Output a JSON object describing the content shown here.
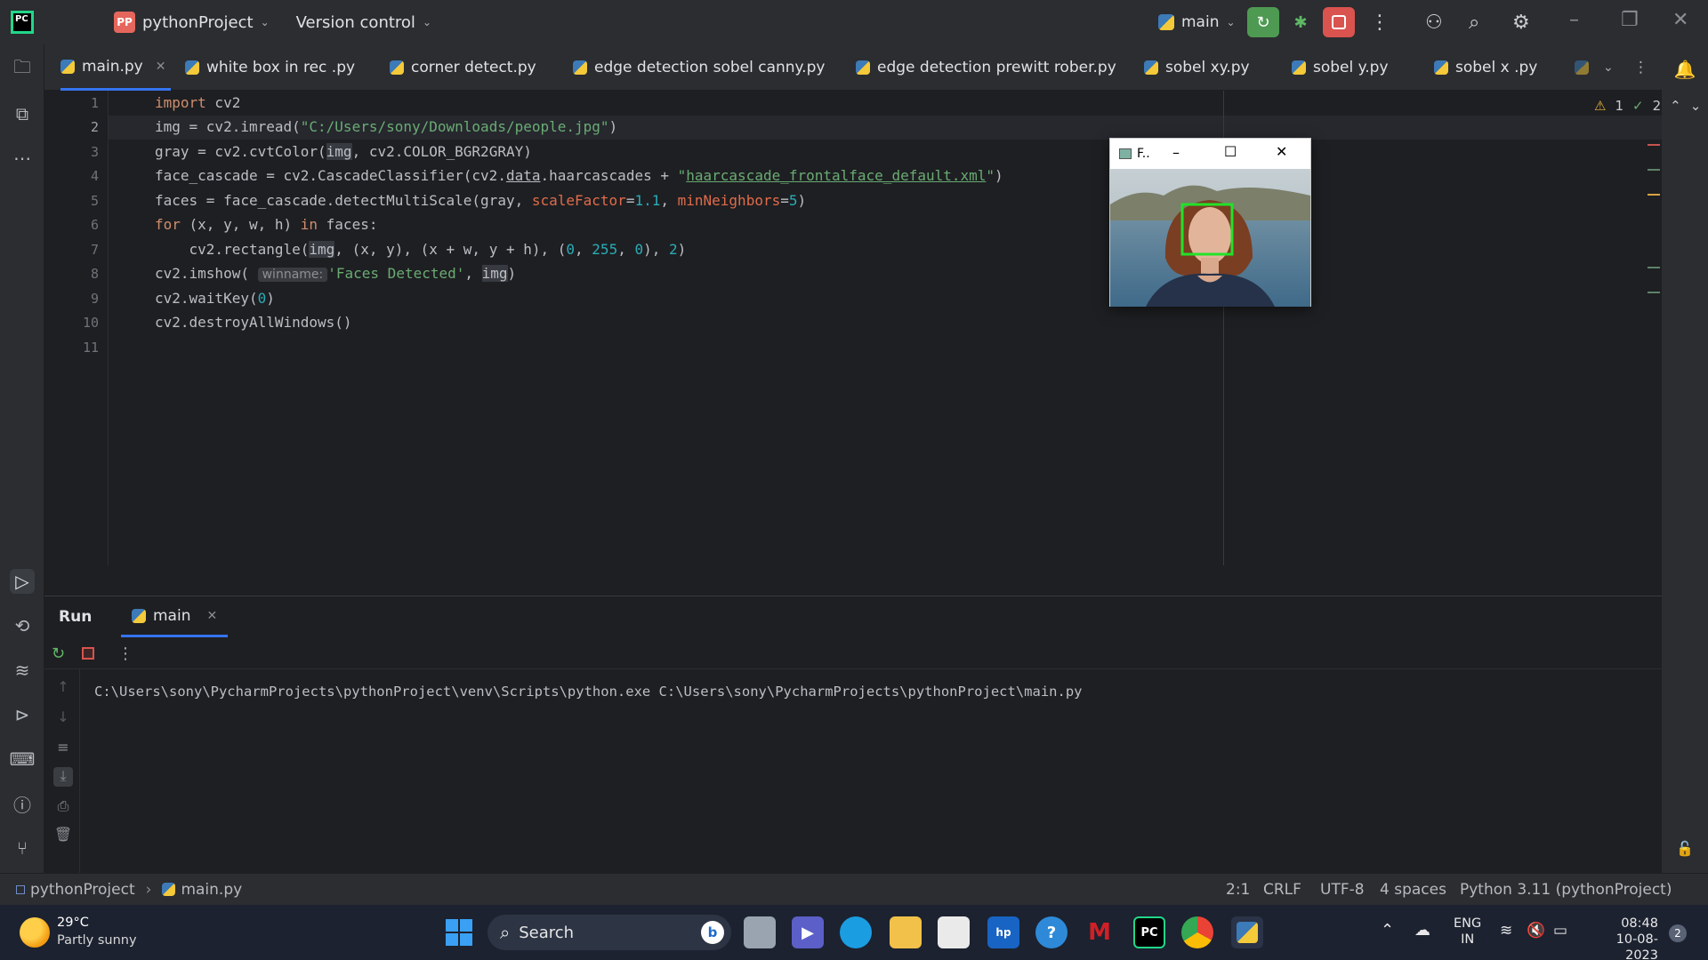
{
  "titlebar": {
    "project_badge": "PP",
    "project_name": "pythonProject",
    "version_control": "Version control",
    "branch": "main"
  },
  "tabs": [
    {
      "label": "main.py",
      "active": true
    },
    {
      "label": "white box in rec .py"
    },
    {
      "label": "corner detect.py"
    },
    {
      "label": "edge detection sobel canny.py"
    },
    {
      "label": "edge detection prewitt rober.py"
    },
    {
      "label": "sobel xy.py"
    },
    {
      "label": "sobel y.py"
    },
    {
      "label": "sobel x .py"
    }
  ],
  "editor": {
    "line_numbers": [
      "1",
      "2",
      "3",
      "4",
      "5",
      "6",
      "7",
      "8",
      "9",
      "10",
      "11"
    ],
    "warnings": "1",
    "weak_warnings": "2",
    "code": {
      "l1_kw": "import",
      "l1_rest": " cv2",
      "l2_a": "img = cv2.imread(",
      "l2_str": "\"C:/Users/sony/Downloads/people.jpg\"",
      "l2_b": ")",
      "l3_a": "gray = cv2.cvtColor(",
      "l3_img": "img",
      "l3_b": ", cv2.COLOR_BGR2GRAY)",
      "l4_a": "face_cascade = cv2.CascadeClassifier(cv2.",
      "l4_data": "data",
      "l4_b": ".haarcascades + ",
      "l4_q1": "\"",
      "l4_str": "haarcascade_frontalface_default.xml",
      "l4_q2": "\"",
      "l4_c": ")",
      "l5_a": "faces = face_cascade.detectMultiScale(gray, ",
      "l5_p1": "scaleFactor",
      "l5_eq1": "=",
      "l5_n1": "1.1",
      "l5_sep": ", ",
      "l5_p2": "minNeighbors",
      "l5_eq2": "=",
      "l5_n2": "5",
      "l5_b": ")",
      "l6_kw1": "for",
      "l6_a": " (x, y, w, h) ",
      "l6_kw2": "in",
      "l6_b": " faces:",
      "l7_a": "    cv2.rectangle(",
      "l7_img": "img",
      "l7_b": ", (x, y), (x + w, y + h), (",
      "l7_n1": "0",
      "l7_c1": ", ",
      "l7_n2": "255",
      "l7_c2": ", ",
      "l7_n3": "0",
      "l7_d": "), ",
      "l7_n4": "2",
      "l7_e": ")",
      "l8_a": "cv2.imshow(",
      "l8_hint": "winname:",
      "l8_str": "'Faces Detected'",
      "l8_b": ", ",
      "l8_img": "img",
      "l8_c": ")",
      "l9_a": "cv2.waitKey(",
      "l9_n": "0",
      "l9_b": ")",
      "l10": "cv2.destroyAllWindows()"
    }
  },
  "face_window": {
    "title": "F..",
    "box_color": "#22e22a"
  },
  "run": {
    "title": "Run",
    "tab": "main",
    "console": "C:\\Users\\sony\\PycharmProjects\\pythonProject\\venv\\Scripts\\python.exe C:\\Users\\sony\\PycharmProjects\\pythonProject\\main.py"
  },
  "statusbar": {
    "project": "pythonProject",
    "file": "main.py",
    "position": "2:1",
    "line_sep": "CRLF",
    "encoding": "UTF-8",
    "indent": "4 spaces",
    "interpreter": "Python 3.11 (pythonProject)"
  },
  "taskbar": {
    "temp": "29°C",
    "weather": "Partly sunny",
    "search": "Search",
    "lang1": "ENG",
    "lang2": "IN",
    "time": "08:48",
    "date": "10-08-2023",
    "notif_count": "2"
  },
  "colors": {
    "accent": "#3574f0",
    "run_green": "#4e9a52",
    "stop_red": "#d9534f"
  }
}
